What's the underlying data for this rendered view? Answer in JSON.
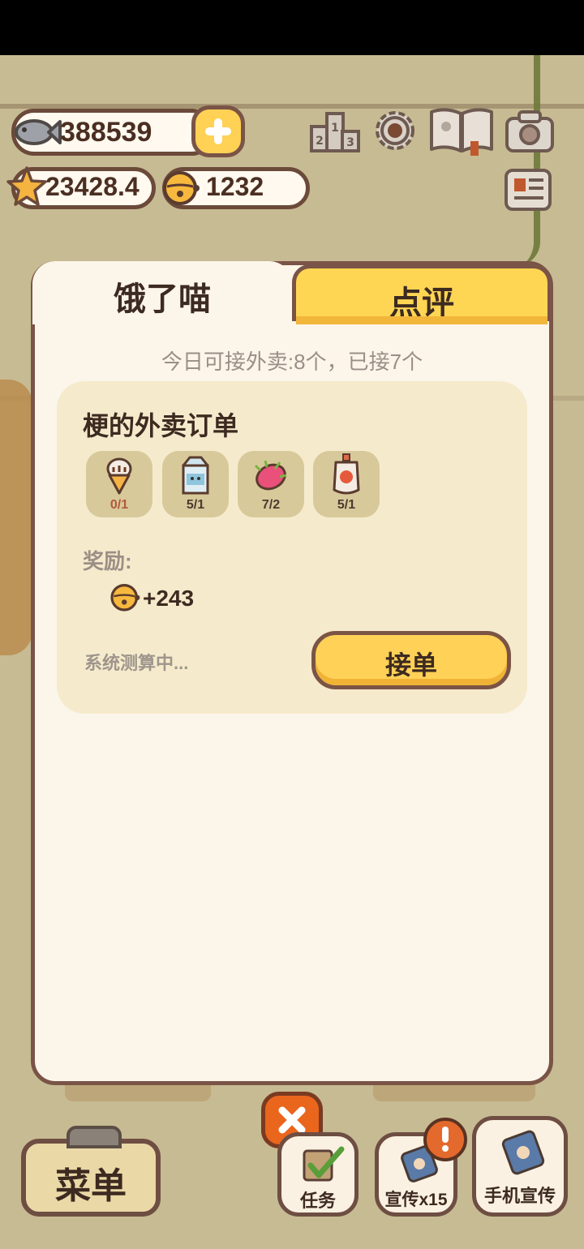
{
  "currency": {
    "fish": "388539",
    "stars": "23428.4",
    "bells": "1232"
  },
  "tabs": {
    "active": "饿了喵",
    "inactive": "点评"
  },
  "delivery_info": "今日可接外卖:8个，已接7个",
  "order": {
    "title": "梗的外卖订单",
    "items": [
      {
        "icon": "ice-cream-icon",
        "count": "0/1",
        "count_color": "#b05a3c"
      },
      {
        "icon": "milk-carton-icon",
        "count": "5/1",
        "count_color": "#4a3a2f"
      },
      {
        "icon": "dragon-fruit-icon",
        "count": "7/2",
        "count_color": "#4a3a2f"
      },
      {
        "icon": "jam-bottle-icon",
        "count": "5/1",
        "count_color": "#4a3a2f"
      }
    ],
    "reward_label": "奖励:",
    "reward_value": "+243",
    "status": "系统测算中...",
    "accept_label": "接单"
  },
  "bottom": {
    "menu": "菜单",
    "tasks": "任务",
    "promote": "宣传x15",
    "phone_promote": "手机宣传"
  },
  "colors": {
    "accent_yellow": "#ffd157",
    "border_brown": "#7a5446",
    "panel_bg": "#fcf5ea",
    "card_bg": "#f5ebcc",
    "close_orange": "#e9661c"
  }
}
